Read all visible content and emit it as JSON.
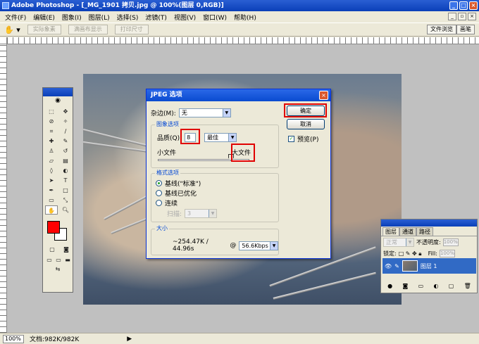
{
  "window": {
    "title": "Adobe Photoshop - [_MG_1901 拷贝.jpg @ 100%(图层 0,RGB)]"
  },
  "menu": [
    "文件(F)",
    "编辑(E)",
    "图象(I)",
    "图层(L)",
    "选择(S)",
    "滤镜(T)",
    "视图(V)",
    "窗口(W)",
    "帮助(H)"
  ],
  "options": {
    "buttons": [
      "实际象素",
      "满画布显示",
      "打印尺寸"
    ],
    "palette_tabs": [
      "文件浏览",
      "画笔"
    ]
  },
  "status": {
    "zoom": "100%",
    "doc": "文档:982K/982K"
  },
  "dialog": {
    "title": "JPEG 选项",
    "matte_label": "杂边(M):",
    "matte_value": "无",
    "image_options_label": "图象选项",
    "quality_label": "品质(Q):",
    "quality_value": "8",
    "quality_preset": "最佳",
    "small_file": "小文件",
    "large_file": "大文件",
    "format_options_label": "格式选项",
    "format_baseline_standard": "基线(\"标准\")",
    "format_baseline_optimized": "基线已优化",
    "format_progressive": "连续",
    "scans_label": "扫描:",
    "scans_value": "3",
    "size_label": "大小",
    "size_value": "~254.47K / 44.96s",
    "at": "@",
    "speed_value": "56.6Kbps",
    "ok": "确定",
    "cancel": "取消",
    "preview": "预览(P)",
    "quality_level": 0.8
  },
  "layers": {
    "tabs": [
      "图层",
      "通道",
      "路径"
    ],
    "blend_mode": "正常",
    "opacity_label": "不透明度:",
    "opacity_value": "100%",
    "lock_label": "锁定:",
    "fill_label": "Fill:",
    "fill_value": "100%",
    "layer_name": "图层 1"
  }
}
